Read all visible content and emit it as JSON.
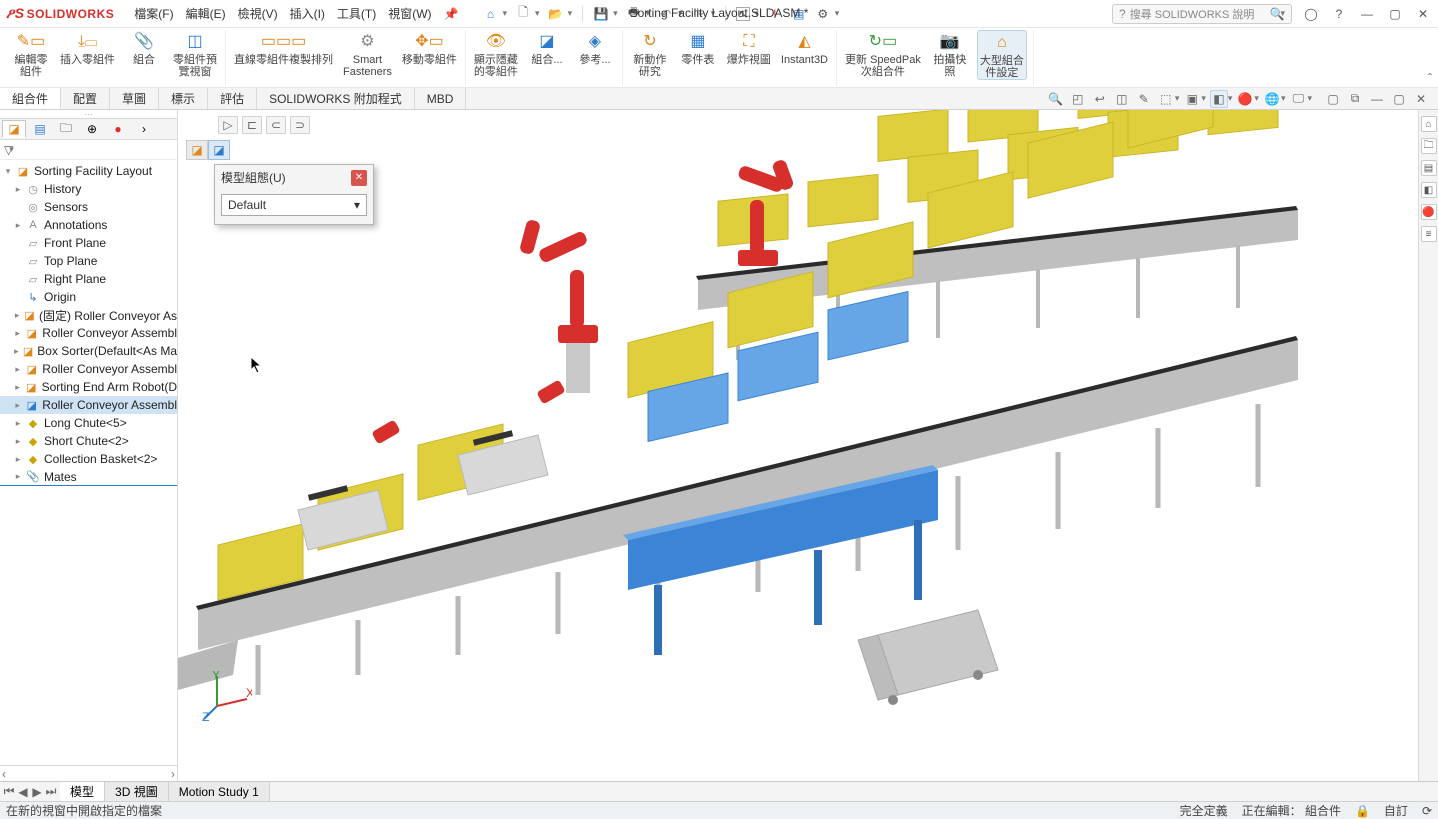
{
  "app": {
    "logo": "SOLIDWORKS",
    "doc_title": "Sorting Facility Layout.SLDASM *"
  },
  "menu": {
    "file": "檔案(F)",
    "edit": "編輯(E)",
    "view": "檢視(V)",
    "insert": "插入(I)",
    "tools": "工具(T)",
    "window": "視窗(W)"
  },
  "search": {
    "placeholder": "搜尋 SOLIDWORKS 說明"
  },
  "ribbon": {
    "edit_comp": "編輯零\n組件",
    "insert_comp": "插入零組件",
    "mate": "組合",
    "comp_preview": "零組件預\n覽視窗",
    "linear_pattern": "直線零組件複製排列",
    "smart": "Smart\nFasteners",
    "move_comp": "移動零組件",
    "show_hidden": "顯示隱藏\n的零組件",
    "assy_feat": "組合...",
    "ref_geo": "參考...",
    "new_motion": "新動作\n研究",
    "bom": "零件表",
    "exploded": "爆炸視圖",
    "instant3d": "Instant3D",
    "update_speedpak": "更新 SpeedPak\n次組合件",
    "snapshot": "拍攝快\n照",
    "large_assy": "大型組合\n件設定"
  },
  "tabs": {
    "assembly": "組合件",
    "layout": "配置",
    "sketch": "草圖",
    "markup": "標示",
    "evaluate": "評估",
    "addins": "SOLIDWORKS 附加程式",
    "mbd": "MBD"
  },
  "popup": {
    "title": "模型組態(U)",
    "value": "Default"
  },
  "tree": {
    "root": "Sorting Facility Layout",
    "history": "History",
    "sensors": "Sensors",
    "annotations": "Annotations",
    "front": "Front Plane",
    "top": "Top Plane",
    "right": "Right Plane",
    "origin": "Origin",
    "n1": "(固定) Roller Conveyor As",
    "n2": "Roller Conveyor Assembl",
    "n3": "Box Sorter(Default<As Ma",
    "n4": "Roller Conveyor Assembl",
    "n5": "Sorting End Arm Robot(D",
    "n6": "Roller Conveyor Assembl",
    "n7": "Long Chute<5>",
    "n8": "Short Chute<2>",
    "n9": "Collection Basket<2>",
    "mates": "Mates"
  },
  "bottom_tabs": {
    "model": "模型",
    "view3d": "3D 視圖",
    "motion": "Motion Study 1"
  },
  "status": {
    "msg": "在新的視窗中開啟指定的檔案",
    "s1": "完全定義",
    "s2": "正在編輯： 組合件",
    "s3": "自訂"
  }
}
